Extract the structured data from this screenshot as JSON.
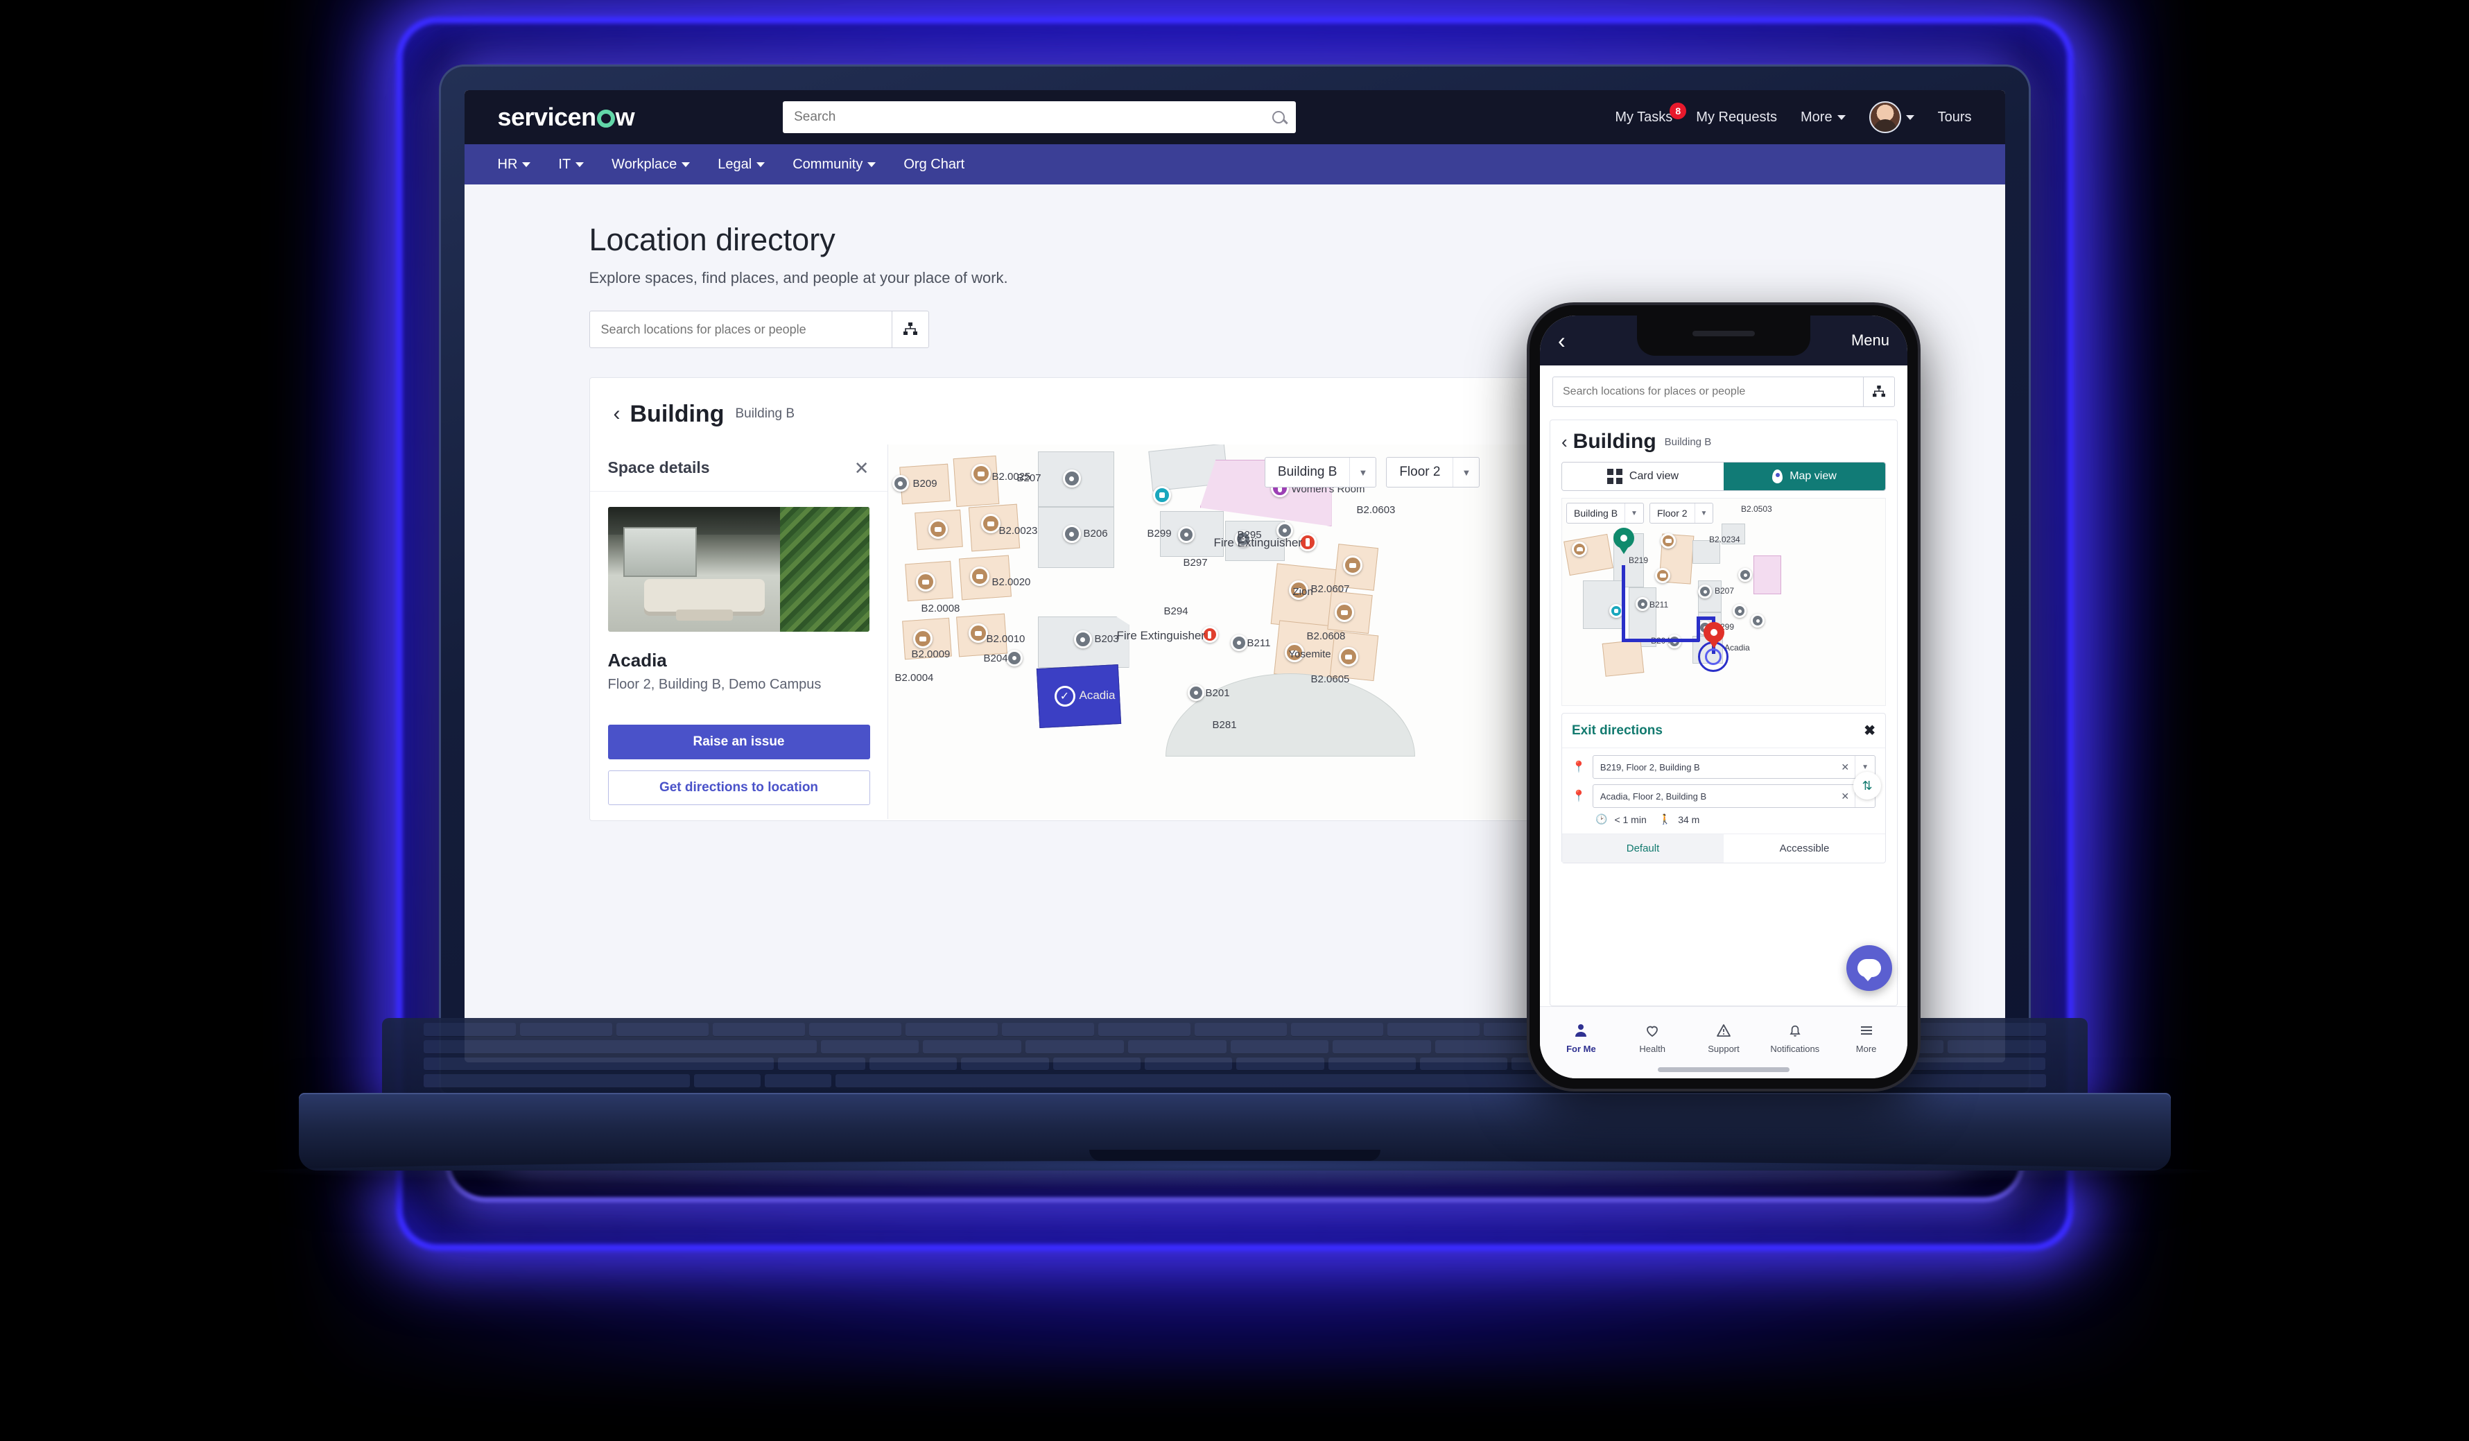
{
  "desktop": {
    "brand": "servicenow",
    "global_search_placeholder": "Search",
    "top_links": {
      "my_tasks": "My Tasks",
      "my_tasks_badge": "8",
      "my_requests": "My Requests",
      "more": "More",
      "tours": "Tours"
    },
    "nav": [
      {
        "label": "HR",
        "has_caret": true
      },
      {
        "label": "IT",
        "has_caret": true
      },
      {
        "label": "Workplace",
        "has_caret": true
      },
      {
        "label": "Legal",
        "has_caret": true
      },
      {
        "label": "Community",
        "has_caret": true
      },
      {
        "label": "Org Chart",
        "has_caret": false
      }
    ],
    "page_title": "Location directory",
    "page_subtitle": "Explore spaces, find places, and people at your place of work.",
    "location_search_placeholder": "Search locations for places or people",
    "breadcrumb": {
      "title": "Building",
      "subtitle": "Building B"
    },
    "view_toggle": {
      "card": "Card view",
      "map": "Map view",
      "active": "map"
    },
    "space_details": {
      "header": "Space details",
      "name": "Acadia",
      "location": "Floor 2, Building B, Demo Campus",
      "primary_button": "Raise an issue",
      "secondary_button": "Get directions to location"
    },
    "map": {
      "building_select": "Building B",
      "floor_select": "Floor 2",
      "selected_room": "Acadia",
      "labels": [
        "B209",
        "B207",
        "B206",
        "B203",
        "B204",
        "B201",
        "B211",
        "B294",
        "B295",
        "B297",
        "B299",
        "B2.0023",
        "B2.0025",
        "B2.0020",
        "B2.0004",
        "B2.0008",
        "B2.0009",
        "B2.0010",
        "B2.0607",
        "B2.0608",
        "B2.0605",
        "B2.0603",
        "B281",
        "Zion",
        "Yosemite",
        "Women's Room",
        "Fire Extinguisher"
      ]
    }
  },
  "phone": {
    "status_back": "‹",
    "menu": "Menu",
    "search_placeholder": "Search locations for places or people",
    "breadcrumb": {
      "title": "Building",
      "subtitle": "Building B"
    },
    "view_toggle": {
      "card": "Card view",
      "map": "Map view",
      "active": "map"
    },
    "map": {
      "building_select": "Building B",
      "floor_select": "Floor 2",
      "labels": [
        "B219",
        "B211",
        "B207",
        "B299",
        "B204",
        "B2.0503",
        "B2.0234",
        "Acadia"
      ]
    },
    "exit_directions": {
      "title": "Exit directions",
      "origin": "B219, Floor 2, Building B",
      "destination": "Acadia, Floor 2, Building B",
      "duration": "< 1 min",
      "distance": "34 m",
      "tabs": [
        {
          "label": "Default",
          "active": true
        },
        {
          "label": "Accessible",
          "active": false
        }
      ]
    },
    "bottom_nav": [
      {
        "label": "For Me",
        "icon": "person-icon",
        "active": true
      },
      {
        "label": "Health",
        "icon": "heart-icon",
        "active": false
      },
      {
        "label": "Support",
        "icon": "warning-triangle-icon",
        "active": false
      },
      {
        "label": "Notifications",
        "icon": "bell-icon",
        "active": false
      },
      {
        "label": "More",
        "icon": "hamburger-icon",
        "active": false
      }
    ]
  },
  "colors": {
    "brand_navy": "#121528",
    "nav_blue": "#3b3f96",
    "primary": "#4a52c9",
    "teal": "#117b76",
    "badge_red": "#e8192c"
  }
}
